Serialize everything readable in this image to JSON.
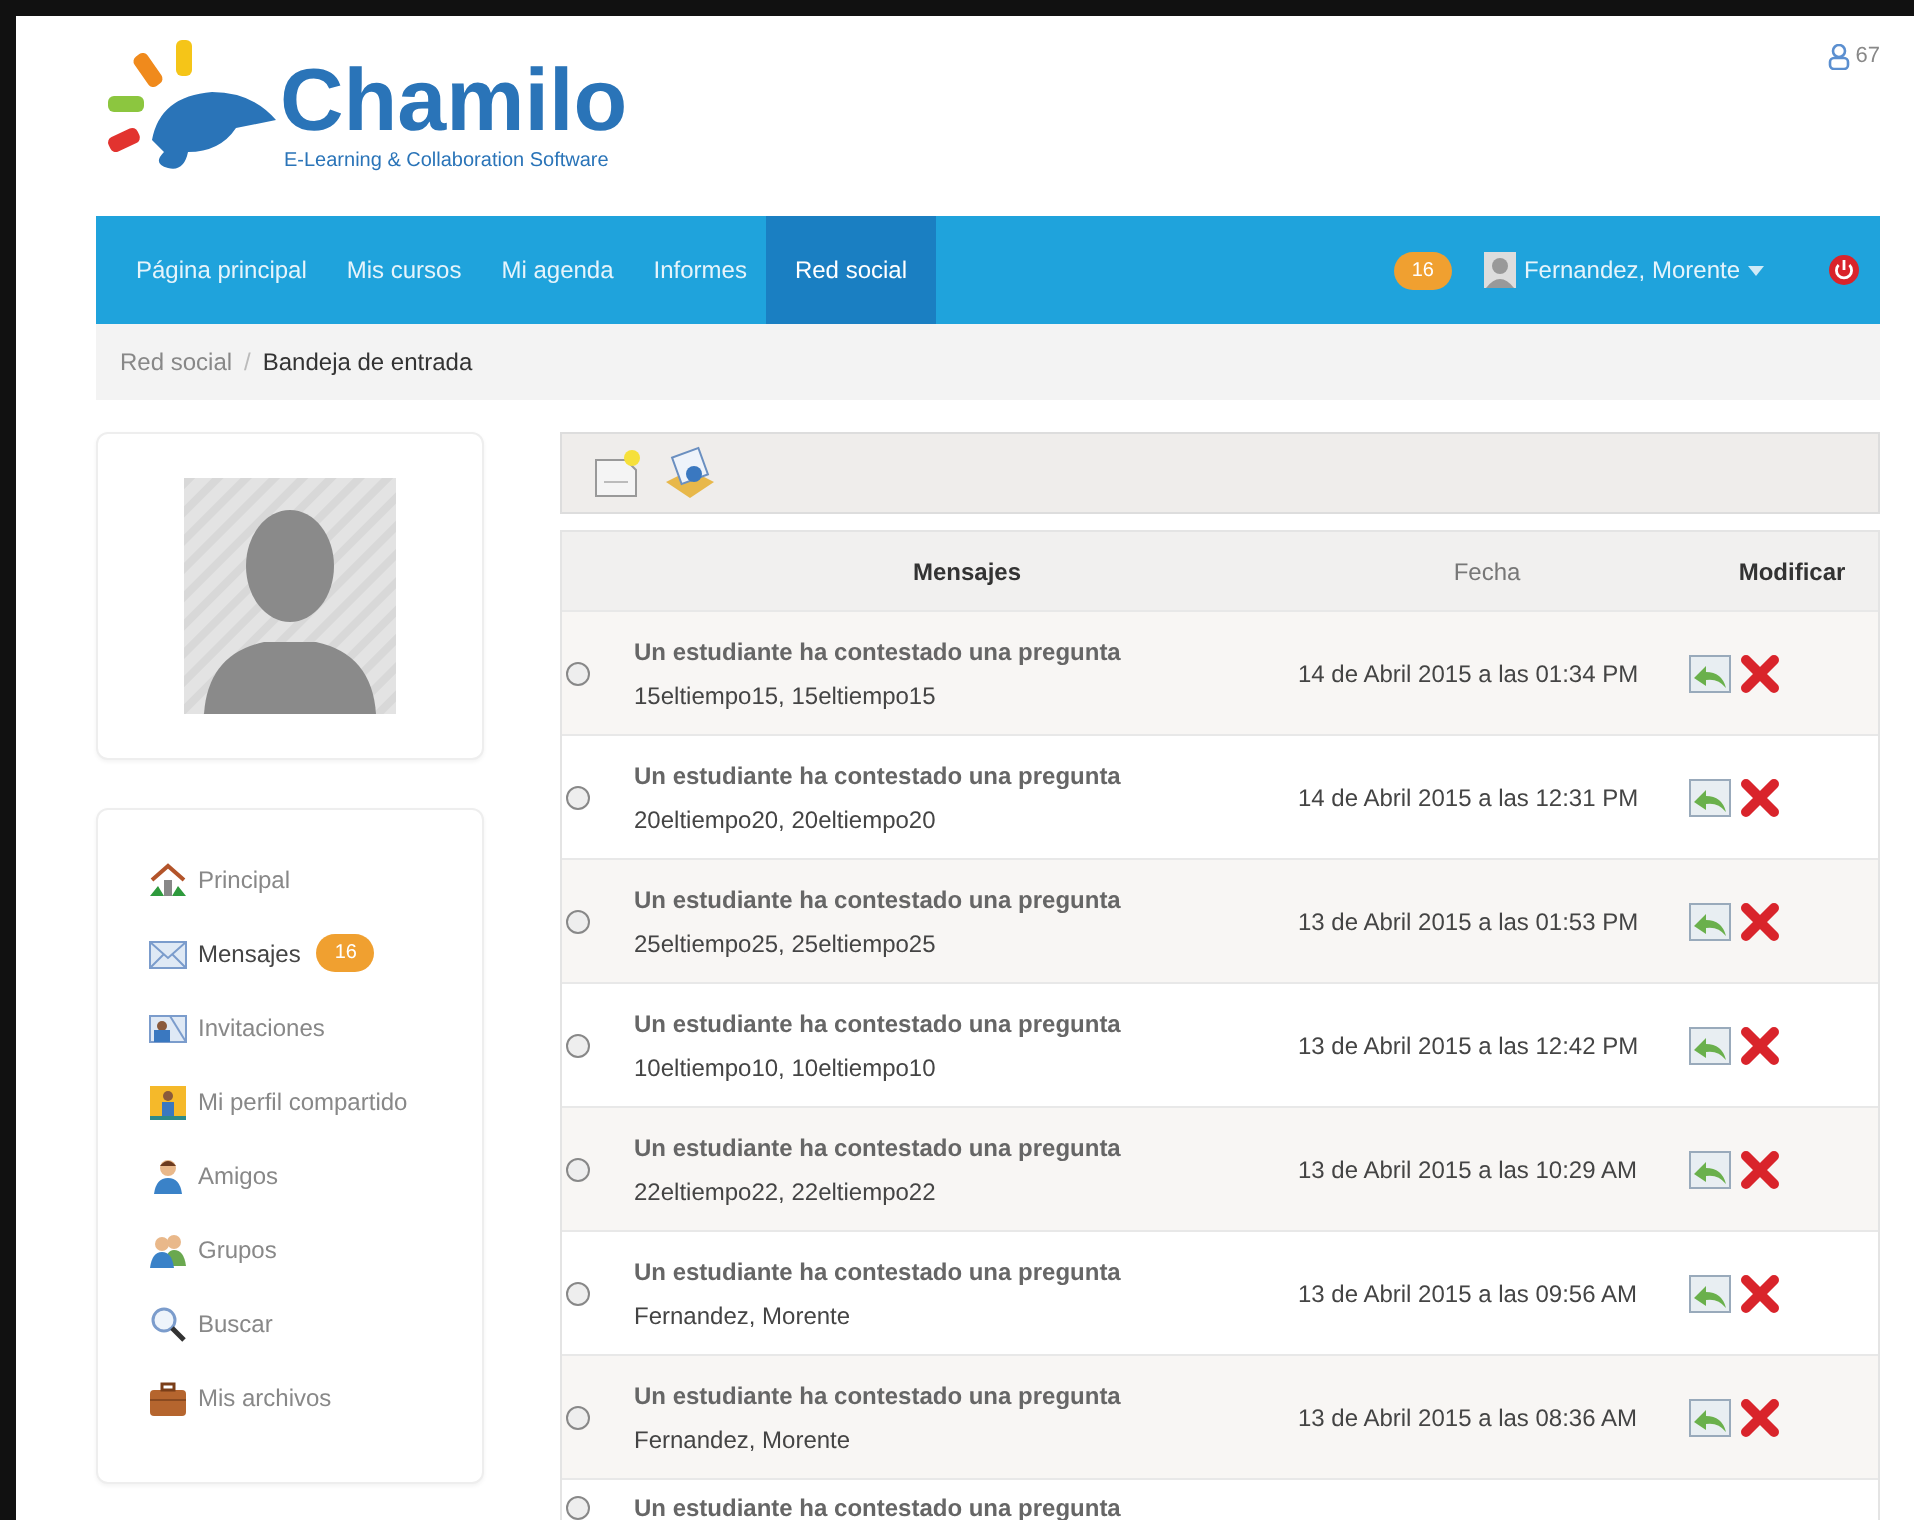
{
  "header": {
    "logo_title": "Chamilo",
    "logo_subtitle": "E-Learning & Collaboration Software",
    "online_count": "67"
  },
  "navbar": {
    "items": [
      {
        "label": "Página principal",
        "selected": false
      },
      {
        "label": "Mis cursos",
        "selected": false
      },
      {
        "label": "Mi agenda",
        "selected": false
      },
      {
        "label": "Informes",
        "selected": false
      },
      {
        "label": "Red social",
        "selected": true
      }
    ],
    "notifications": "16",
    "user_name": "Fernandez, Morente"
  },
  "breadcrumb": {
    "items": [
      "Red social",
      "Bandeja de entrada"
    ],
    "separator": "/"
  },
  "sidebar": {
    "items": [
      {
        "label": "Principal",
        "selected": false
      },
      {
        "label": "Mensajes",
        "selected": true,
        "badge": "16"
      },
      {
        "label": "Invitaciones",
        "selected": false
      },
      {
        "label": "Mi perfil compartido",
        "selected": false
      },
      {
        "label": "Amigos",
        "selected": false
      },
      {
        "label": "Grupos",
        "selected": false
      },
      {
        "label": "Buscar",
        "selected": false
      },
      {
        "label": "Mis archivos",
        "selected": false
      }
    ]
  },
  "table": {
    "columns": [
      "Mensajes",
      "Fecha",
      "Modificar"
    ],
    "rows": [
      {
        "selected": false,
        "subject": "Un estudiante ha contestado una pregunta",
        "sender": "15eltiempo15, 15eltiempo15",
        "date": "14 de Abril 2015 a las 01:34 PM"
      },
      {
        "selected": false,
        "subject": "Un estudiante ha contestado una pregunta",
        "sender": "20eltiempo20, 20eltiempo20",
        "date": "14 de Abril 2015 a las 12:31 PM"
      },
      {
        "selected": false,
        "subject": "Un estudiante ha contestado una pregunta",
        "sender": "25eltiempo25, 25eltiempo25",
        "date": "13 de Abril 2015 a las 01:53 PM"
      },
      {
        "selected": false,
        "subject": "Un estudiante ha contestado una pregunta",
        "sender": "10eltiempo10, 10eltiempo10",
        "date": "13 de Abril 2015 a las 12:42 PM"
      },
      {
        "selected": false,
        "subject": "Un estudiante ha contestado una pregunta",
        "sender": "22eltiempo22, 22eltiempo22",
        "date": "13 de Abril 2015 a las 10:29 AM"
      },
      {
        "selected": false,
        "subject": "Un estudiante ha contestado una pregunta",
        "sender": "Fernandez, Morente",
        "date": "13 de Abril 2015 a las 09:56 AM"
      },
      {
        "selected": false,
        "subject": "Un estudiante ha contestado una pregunta",
        "sender": "Fernandez, Morente",
        "date": "13 de Abril 2015 a las 08:36 AM"
      },
      {
        "selected": false,
        "subject": "Un estudiante ha contestado una pregunta"
      }
    ]
  }
}
